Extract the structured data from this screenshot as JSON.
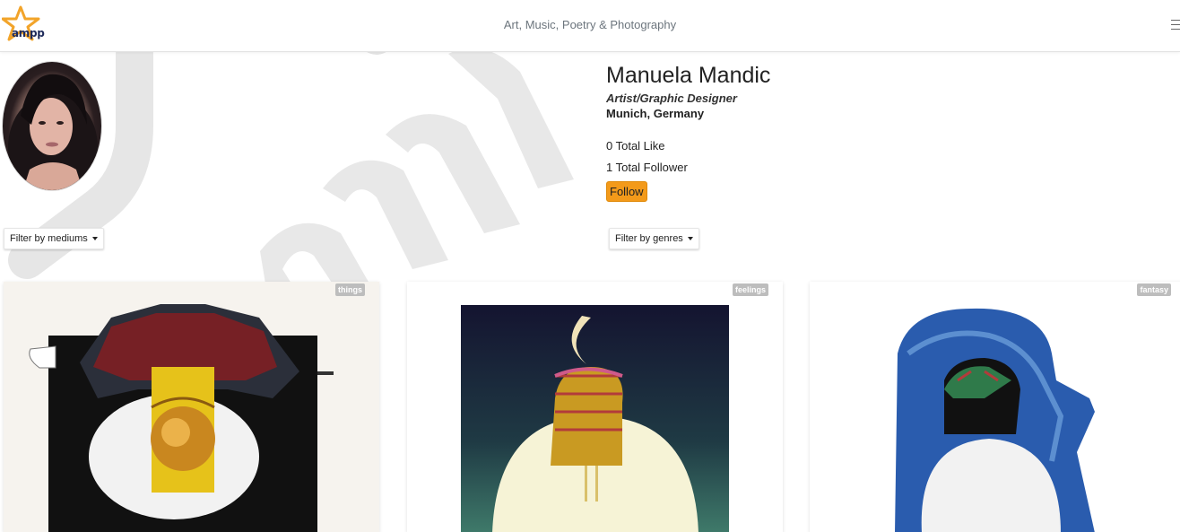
{
  "navbar": {
    "logo_text": "ampp",
    "tagline": "Art, Music, Poetry & Photography"
  },
  "profile": {
    "name": "Manuela Mandic",
    "role": "Artist/Graphic Designer",
    "location": "Munich, Germany",
    "likes": "0 Total Like",
    "followers": "1 Total Follower",
    "follow_label": "Follow"
  },
  "filters": {
    "mediums_label": "Filter by mediums",
    "genres_label": "Filter by genres"
  },
  "cards": [
    {
      "genre": "things"
    },
    {
      "genre": "feelings"
    },
    {
      "genre": "fantasy"
    }
  ],
  "colors": {
    "accent": "#f39a1a",
    "logo_star": "#f2a42a",
    "logo_text": "#1e2a5a",
    "badge": "#bdbdbd"
  }
}
